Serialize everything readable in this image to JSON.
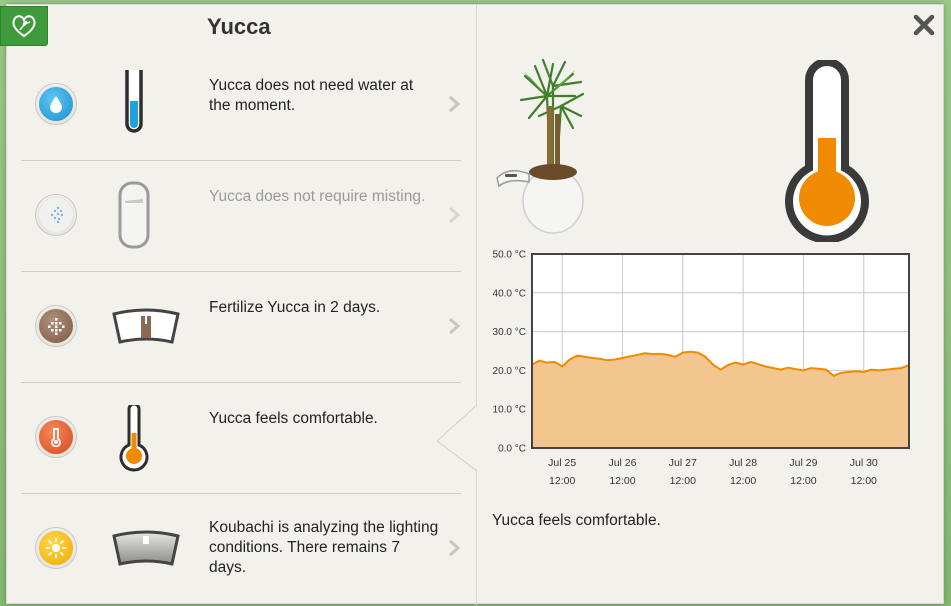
{
  "header": {
    "title": "Yucca"
  },
  "rows": [
    {
      "text": "Yucca does not need water at the moment.",
      "muted": false,
      "icon": "water-drop-icon",
      "accent": "#1a9ad6"
    },
    {
      "text": "Yucca does not require misting.",
      "muted": true,
      "icon": "mist-icon",
      "accent": "#7ab4d8"
    },
    {
      "text": "Fertilize Yucca in 2 days.",
      "muted": false,
      "icon": "fertilizer-icon",
      "accent": "#8a6a55"
    },
    {
      "text": "Yucca feels comfortable.",
      "muted": false,
      "icon": "thermometer-icon",
      "accent": "#e0562a"
    },
    {
      "text": "Koubachi is analyzing the lighting conditions. There remains 7 days.",
      "muted": false,
      "icon": "sun-icon",
      "accent": "#f2b800"
    }
  ],
  "detail": {
    "caption": "Yucca feels comfortable.",
    "accent": "#f08a00"
  },
  "chart_data": {
    "type": "area",
    "title": "",
    "xlabel": "",
    "ylabel": "",
    "y_unit": "°C",
    "ylim": [
      0,
      50
    ],
    "yticks": [
      "50.0 °C",
      "40.0 °C",
      "30.0 °C",
      "20.0 °C",
      "10.0 °C",
      "0.0 °C"
    ],
    "xticks": [
      {
        "day": "Jul 25",
        "time": "12:00"
      },
      {
        "day": "Jul 26",
        "time": "12:00"
      },
      {
        "day": "Jul 27",
        "time": "12:00"
      },
      {
        "day": "Jul 28",
        "time": "12:00"
      },
      {
        "day": "Jul 29",
        "time": "12:00"
      },
      {
        "day": "Jul 30",
        "time": "12:00"
      }
    ],
    "x_start": "Jul 25 00:00",
    "x_end": "Jul 31 06:00",
    "grid": true,
    "series": [
      {
        "color": "#f08a00",
        "fill": "#f3c690",
        "points": [
          [
            "Jul 25 00:00",
            21.5
          ],
          [
            "Jul 25 03:00",
            22.5
          ],
          [
            "Jul 25 06:00",
            22.0
          ],
          [
            "Jul 25 09:00",
            22.2
          ],
          [
            "Jul 25 12:00",
            21.0
          ],
          [
            "Jul 25 15:00",
            22.8
          ],
          [
            "Jul 25 18:00",
            23.8
          ],
          [
            "Jul 25 21:00",
            23.5
          ],
          [
            "Jul 26 00:00",
            23.2
          ],
          [
            "Jul 26 03:00",
            23.0
          ],
          [
            "Jul 26 06:00",
            22.6
          ],
          [
            "Jul 26 09:00",
            22.8
          ],
          [
            "Jul 26 12:00",
            23.2
          ],
          [
            "Jul 26 15:00",
            23.6
          ],
          [
            "Jul 26 18:00",
            24.0
          ],
          [
            "Jul 26 21:00",
            24.4
          ],
          [
            "Jul 27 00:00",
            24.2
          ],
          [
            "Jul 27 03:00",
            24.3
          ],
          [
            "Jul 27 06:00",
            24.0
          ],
          [
            "Jul 27 09:00",
            23.5
          ],
          [
            "Jul 27 12:00",
            24.6
          ],
          [
            "Jul 27 15:00",
            24.8
          ],
          [
            "Jul 27 18:00",
            24.6
          ],
          [
            "Jul 27 21:00",
            23.5
          ],
          [
            "Jul 28 00:00",
            21.5
          ],
          [
            "Jul 28 03:00",
            20.2
          ],
          [
            "Jul 28 06:00",
            21.4
          ],
          [
            "Jul 28 09:00",
            22.0
          ],
          [
            "Jul 28 12:00",
            21.5
          ],
          [
            "Jul 28 15:00",
            22.2
          ],
          [
            "Jul 28 18:00",
            21.6
          ],
          [
            "Jul 28 21:00",
            21.0
          ],
          [
            "Jul 29 00:00",
            20.6
          ],
          [
            "Jul 29 03:00",
            20.2
          ],
          [
            "Jul 29 06:00",
            20.7
          ],
          [
            "Jul 29 09:00",
            20.3
          ],
          [
            "Jul 29 12:00",
            20.0
          ],
          [
            "Jul 29 15:00",
            20.6
          ],
          [
            "Jul 29 18:00",
            20.4
          ],
          [
            "Jul 29 21:00",
            20.2
          ],
          [
            "Jul 30 00:00",
            18.6
          ],
          [
            "Jul 30 03:00",
            19.4
          ],
          [
            "Jul 30 06:00",
            19.6
          ],
          [
            "Jul 30 09:00",
            19.8
          ],
          [
            "Jul 30 12:00",
            19.6
          ],
          [
            "Jul 30 15:00",
            20.2
          ],
          [
            "Jul 30 18:00",
            20.0
          ],
          [
            "Jul 30 21:00",
            20.2
          ],
          [
            "Jul 31 00:00",
            20.4
          ],
          [
            "Jul 31 03:00",
            20.6
          ],
          [
            "Jul 31 06:00",
            21.4
          ]
        ]
      }
    ]
  }
}
